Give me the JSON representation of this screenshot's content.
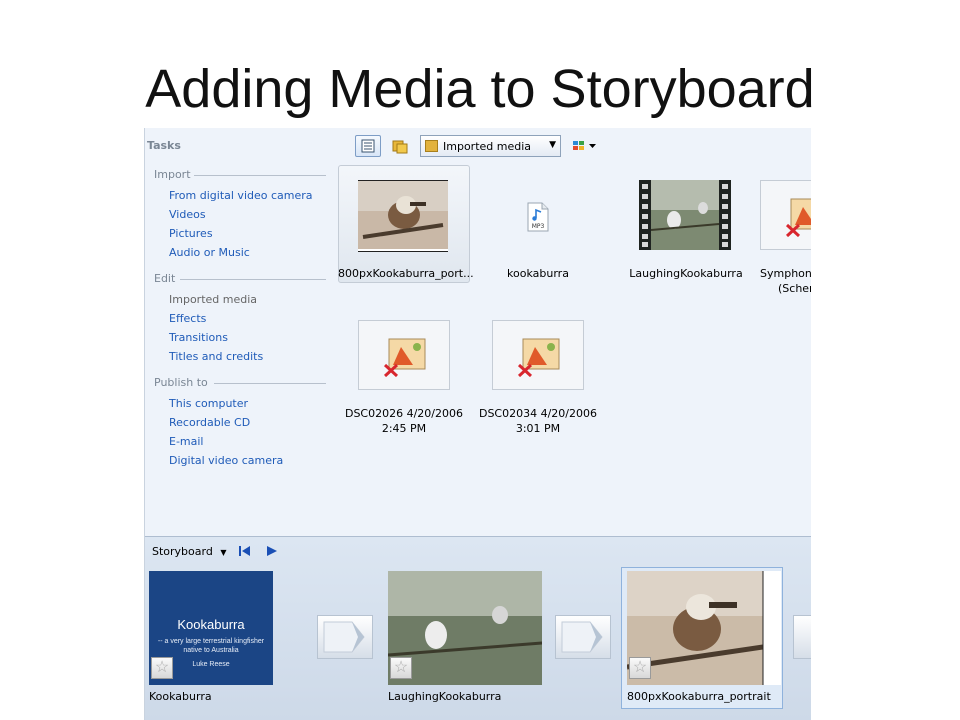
{
  "slide": {
    "title": "Adding Media to Storyboard"
  },
  "tasks": {
    "header": "Tasks",
    "sections": [
      {
        "title": "Import",
        "items": [
          "From digital video camera",
          "Videos",
          "Pictures",
          "Audio or Music"
        ]
      },
      {
        "title": "Edit",
        "items": [
          "Imported media",
          "Effects",
          "Transitions",
          "Titles and credits"
        ]
      },
      {
        "title": "Publish to",
        "items": [
          "This computer",
          "Recordable CD",
          "E-mail",
          "Digital video camera"
        ]
      }
    ]
  },
  "toolbar": {
    "collection_selected": "Imported media"
  },
  "media": [
    {
      "label": "800pxKookaburra_port...",
      "type": "photo"
    },
    {
      "label": "kookaburra",
      "type": "audio",
      "icon_text": "MP3"
    },
    {
      "label": "LaughingKookaburra",
      "type": "video"
    },
    {
      "label_line1": "Symphon",
      "label_line2": "(Scher",
      "type": "missing"
    },
    {
      "label_line1": "DSC02026 4/20/2006",
      "label_line2": "2:45 PM",
      "type": "missing"
    },
    {
      "label_line1": "DSC02034 4/20/2006",
      "label_line2": "3:01 PM",
      "type": "missing"
    }
  ],
  "storyboard": {
    "label": "Storyboard",
    "items": [
      {
        "label": "Kookaburra",
        "title_text": "Kookaburra",
        "subtitle_text": "-- a very large terrestrial kingfisher native to Australia",
        "author_text": "Luke Reese"
      },
      {
        "label": "LaughingKookaburra"
      },
      {
        "label": "800pxKookaburra_portrait"
      }
    ]
  },
  "colors": {
    "link": "#1f5bb8",
    "pane_bg": "#eef3fa",
    "title_clip_bg": "#1b4585"
  }
}
